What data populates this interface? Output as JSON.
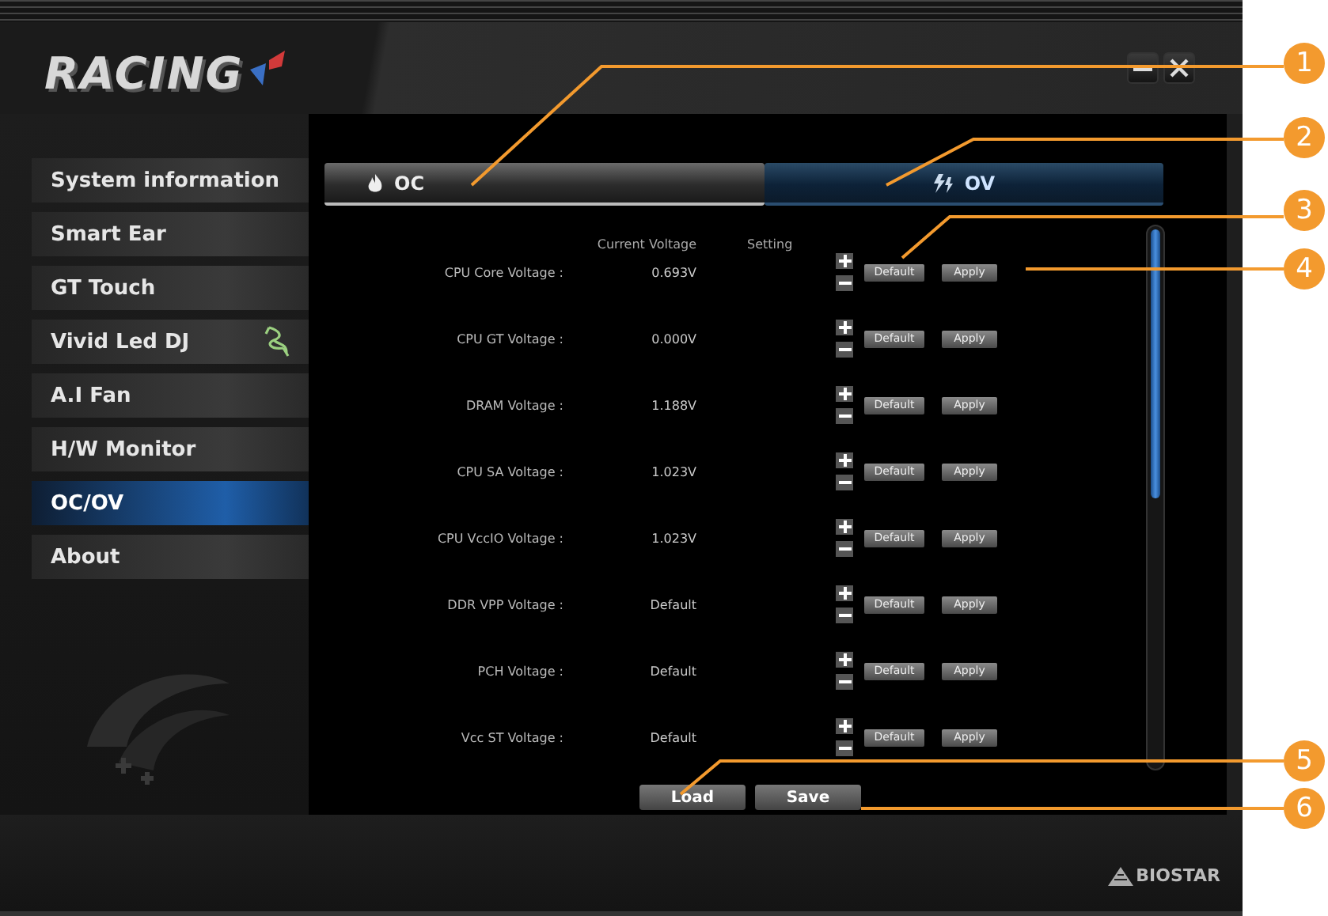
{
  "window": {
    "logo": "RACING",
    "footer_logo": "BIOSTAR"
  },
  "sidebar": {
    "items": [
      {
        "label": "System information",
        "selected": false,
        "icon": false
      },
      {
        "label": "Smart Ear",
        "selected": false,
        "icon": false
      },
      {
        "label": "GT Touch",
        "selected": false,
        "icon": false
      },
      {
        "label": "Vivid Led DJ",
        "selected": false,
        "icon": true
      },
      {
        "label": "A.I Fan",
        "selected": false,
        "icon": false
      },
      {
        "label": "H/W Monitor",
        "selected": false,
        "icon": false
      },
      {
        "label": "OC/OV",
        "selected": true,
        "icon": false
      },
      {
        "label": "About",
        "selected": false,
        "icon": false
      }
    ]
  },
  "tabs": [
    {
      "label": "OC",
      "kind": "flame",
      "selected": false
    },
    {
      "label": "OV",
      "kind": "bolt",
      "selected": true
    }
  ],
  "voltages": {
    "columns": [
      "Current Voltage",
      "Setting"
    ],
    "rows": [
      {
        "name": "CPU Core Voltage :",
        "current": "0.693V",
        "default_button": "Default",
        "apply_button": "Apply"
      },
      {
        "name": "CPU GT Voltage :",
        "current": "0.000V",
        "default_button": "Default",
        "apply_button": "Apply"
      },
      {
        "name": "DRAM Voltage :",
        "current": "1.188V",
        "default_button": "Default",
        "apply_button": "Apply"
      },
      {
        "name": "CPU SA Voltage :",
        "current": "1.023V",
        "default_button": "Default",
        "apply_button": "Apply"
      },
      {
        "name": "CPU VccIO Voltage :",
        "current": "1.023V",
        "default_button": "Default",
        "apply_button": "Apply"
      },
      {
        "name": "DDR VPP Voltage :",
        "current": "Default",
        "default_button": "Default",
        "apply_button": "Apply"
      },
      {
        "name": "PCH Voltage :",
        "current": "Default",
        "default_button": "Default",
        "apply_button": "Apply"
      },
      {
        "name": "Vcc ST Voltage :",
        "current": "Default",
        "default_button": "Default",
        "apply_button": "Apply"
      }
    ]
  },
  "actions": [
    "Load",
    "Save"
  ],
  "callouts": [
    "1",
    "2",
    "3",
    "4",
    "5",
    "6"
  ]
}
